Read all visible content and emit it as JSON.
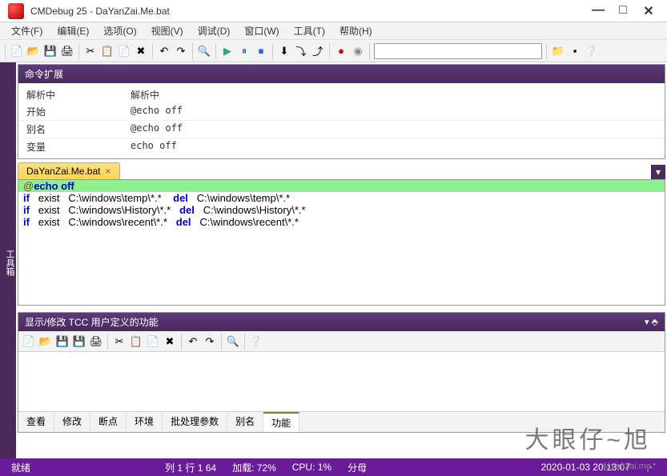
{
  "window": {
    "title": "CMDebug 25 - DaYanZai.Me.bat"
  },
  "menu": {
    "file": "文件(F)",
    "edit": "编辑(E)",
    "options": "选项(O)",
    "view": "视图(V)",
    "debug": "调试(D)",
    "window": "窗口(W)",
    "tools": "工具(T)",
    "help": "帮助(H)"
  },
  "sidebar": {
    "label": "工具箱"
  },
  "cmdext": {
    "title": "命令扩展",
    "rows": [
      {
        "k": "解析中",
        "v": "解析中"
      },
      {
        "k": "开始",
        "v": "@echo off"
      },
      {
        "k": "别名",
        "v": "@echo off"
      },
      {
        "k": "变量",
        "v": "echo off"
      }
    ]
  },
  "filetab": {
    "name": "DaYanZai.Me.bat"
  },
  "editor": {
    "lines": [
      {
        "tokens": [
          {
            "t": "@",
            "c": "str"
          },
          {
            "t": "echo off",
            "c": "kw"
          }
        ],
        "hl": true
      },
      {
        "tokens": [
          {
            "t": "if",
            "c": "kw"
          },
          {
            "t": "   exist   C:\\windows\\temp\\*.*    ",
            "c": ""
          },
          {
            "t": "del",
            "c": "kw"
          },
          {
            "t": "   C:\\windows\\temp\\*.*",
            "c": ""
          }
        ]
      },
      {
        "tokens": [
          {
            "t": "if",
            "c": "kw"
          },
          {
            "t": "   exist   C:\\windows\\History\\*.*   ",
            "c": ""
          },
          {
            "t": "del",
            "c": "kw"
          },
          {
            "t": "   C:\\windows\\History\\*.*",
            "c": ""
          }
        ]
      },
      {
        "tokens": [
          {
            "t": "if",
            "c": "kw"
          },
          {
            "t": "   exist   C:\\windows\\recent\\*.*   ",
            "c": ""
          },
          {
            "t": "del",
            "c": "kw"
          },
          {
            "t": "   C:\\windows\\recent\\*.*",
            "c": ""
          }
        ]
      }
    ]
  },
  "panel2": {
    "title": "显示/修改 TCC 用户定义的功能"
  },
  "tabs": [
    "查看",
    "修改",
    "断点",
    "环境",
    "批处理参数",
    "别名",
    "功能"
  ],
  "tabs_active": 6,
  "status": {
    "ready": "就绪",
    "pos": "列 1 行 1  64",
    "load": "加载: 72%",
    "cpu": "CPU: 1%",
    "label": "分母",
    "time": "2020-01-03  20:13:07"
  },
  "watermark": {
    "main": "大眼仔~旭",
    "sub": "dayanzai.me"
  }
}
